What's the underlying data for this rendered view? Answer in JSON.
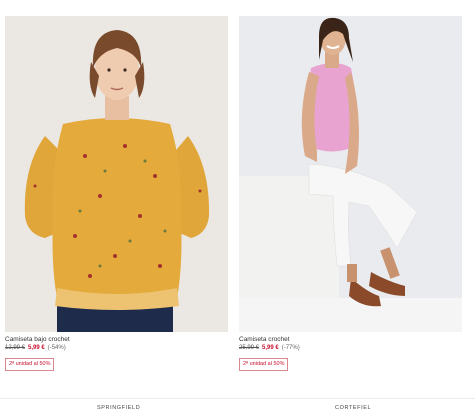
{
  "products": [
    {
      "name": "Camiseta bajo crochet",
      "old_price": "12,99 €",
      "new_price": "5,99 €",
      "discount": "(-54%)",
      "promo": "2ª unidad al 50%",
      "image": "woman-yellow-floral-blouse",
      "brand": "SPRINGFIELD"
    },
    {
      "name": "Camiseta crochet",
      "old_price": "25,99 €",
      "new_price": "5,99 €",
      "discount": "(-77%)",
      "promo": "2ª unidad al 50%",
      "image": "woman-pink-top-white-jeans",
      "brand": "CORTEFIEL"
    }
  ],
  "colors": {
    "sale_red": "#c8102e",
    "promo_border": "#d9888f"
  }
}
